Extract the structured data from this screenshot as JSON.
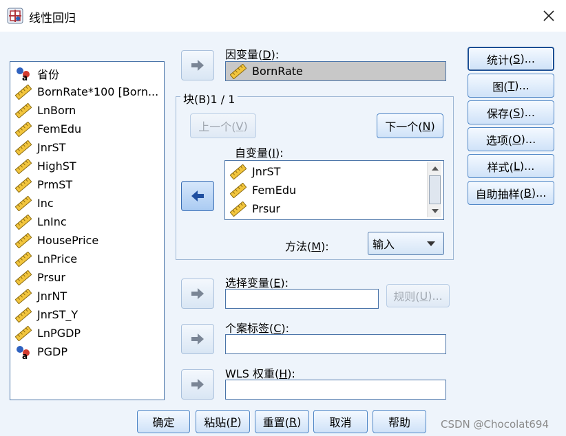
{
  "window": {
    "title": "线性回归",
    "close_glyph": "✕"
  },
  "variables": [
    {
      "label": "省份",
      "icon": "nominal-string-icon"
    },
    {
      "label": "BornRate*100 [Born...",
      "icon": "scale-ruler-icon"
    },
    {
      "label": "LnBorn",
      "icon": "scale-ruler-icon"
    },
    {
      "label": "FemEdu",
      "icon": "scale-ruler-icon"
    },
    {
      "label": "JnrST",
      "icon": "scale-ruler-icon"
    },
    {
      "label": "HighST",
      "icon": "scale-ruler-icon"
    },
    {
      "label": "PrmST",
      "icon": "scale-ruler-icon"
    },
    {
      "label": "Inc",
      "icon": "scale-ruler-icon"
    },
    {
      "label": "LnInc",
      "icon": "scale-ruler-icon"
    },
    {
      "label": "HousePrice",
      "icon": "scale-ruler-icon"
    },
    {
      "label": "LnPrice",
      "icon": "scale-ruler-icon"
    },
    {
      "label": "Prsur",
      "icon": "scale-ruler-icon"
    },
    {
      "label": "JnrNT",
      "icon": "scale-ruler-icon"
    },
    {
      "label": "JnrST_Y",
      "icon": "scale-ruler-icon"
    },
    {
      "label": "LnPGDP",
      "icon": "scale-ruler-icon"
    },
    {
      "label": "PGDP",
      "icon": "nominal-string-icon"
    }
  ],
  "dependent": {
    "label_prefix": "因变量(",
    "label_key": "D",
    "label_suffix": "):",
    "value": "BornRate"
  },
  "block": {
    "title": "块(B)1 / 1",
    "prev_prefix": "上一个(",
    "prev_key": "V",
    "prev_suffix": ")",
    "next_prefix": "下一个(",
    "next_key": "N",
    "next_suffix": ")"
  },
  "independent": {
    "label_prefix": "自变量(",
    "label_key": "I",
    "label_suffix": "):",
    "items": [
      "JnrST",
      "FemEdu",
      "Prsur"
    ]
  },
  "method": {
    "label_prefix": "方法(",
    "label_key": "M",
    "label_suffix": "):",
    "selected": "输入"
  },
  "selection_variable": {
    "label_prefix": "选择变量(",
    "label_key": "E",
    "label_suffix": "):",
    "value": "",
    "rule_prefix": "规则(",
    "rule_key": "U",
    "rule_suffix": ")..."
  },
  "case_labels": {
    "label_prefix": "个案标签(",
    "label_key": "C",
    "label_suffix": "):",
    "value": ""
  },
  "wls_weight": {
    "label_prefix": "WLS 权重(",
    "label_key": "H",
    "label_suffix": "):",
    "value": ""
  },
  "side_buttons": [
    {
      "prefix": "统计(",
      "key": "S",
      "suffix": ")..."
    },
    {
      "prefix": "图(",
      "key": "T",
      "suffix": ")..."
    },
    {
      "prefix": "保存(",
      "key": "S",
      "suffix": ")..."
    },
    {
      "prefix": "选项(",
      "key": "O",
      "suffix": ")..."
    },
    {
      "prefix": "样式(",
      "key": "L",
      "suffix": ")..."
    },
    {
      "prefix": "自助抽样(",
      "key": "B",
      "suffix": ")..."
    }
  ],
  "bottom_buttons": {
    "ok": "确定",
    "paste_prefix": "粘贴(",
    "paste_key": "P",
    "paste_suffix": ")",
    "reset_prefix": "重置(",
    "reset_key": "R",
    "reset_suffix": ")",
    "cancel": "取消",
    "help": "帮助"
  },
  "watermark": "CSDN @Chocolat694",
  "colors": {
    "dialog_bg": "#eef4fb",
    "button_border": "#4f86c6",
    "disabled_text": "#a0a7b0",
    "active_arrow": "#3a6eb4"
  }
}
